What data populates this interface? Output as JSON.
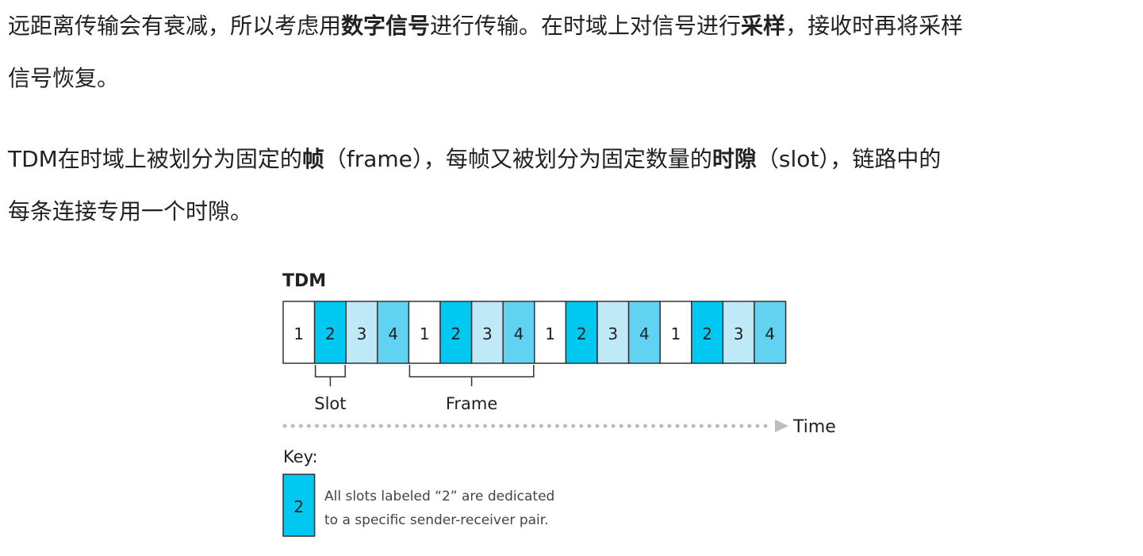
{
  "paragraphs": [
    {
      "lines": [
        [
          {
            "text": " 远距离传输会有衰减，所以考虑用",
            "bold": false
          },
          {
            "text": "数字信号",
            "bold": true
          },
          {
            "text": "进行传输。在时域上对信号进行",
            "bold": false
          },
          {
            "text": "采样",
            "bold": true
          },
          {
            "text": "，接收时再将采样",
            "bold": false
          }
        ],
        [
          {
            "text": "信号恢复。",
            "bold": false
          }
        ]
      ]
    },
    {
      "lines": [
        [
          {
            "text": " TDM在时域上被划分为固定的",
            "bold": false
          },
          {
            "text": "帧",
            "bold": true
          },
          {
            "text": "（frame），每帧又被划分为固定数量的",
            "bold": false
          },
          {
            "text": "时隙",
            "bold": true
          },
          {
            "text": "（slot），链路中的",
            "bold": false
          }
        ],
        [
          {
            "text": "每条连接专用一个时隙。",
            "bold": false
          }
        ]
      ]
    }
  ],
  "diagram": {
    "title": "TDM",
    "slots": [
      "1",
      "2",
      "3",
      "4",
      "1",
      "2",
      "3",
      "4",
      "1",
      "2",
      "3",
      "4",
      "1",
      "2",
      "3",
      "4"
    ],
    "slot_colors": {
      "1": "#ffffff",
      "2": "#00c8f0",
      "3": "#bfe9f7",
      "4": "#62d2f3"
    },
    "slot_label": "Slot",
    "frame_label": "Frame",
    "time_label": "Time",
    "key_label": "Key:",
    "key_slot": "2",
    "key_text_line1": "All slots labeled “2” are dedicated",
    "key_text_line2": "to a specific sender-receiver pair."
  }
}
